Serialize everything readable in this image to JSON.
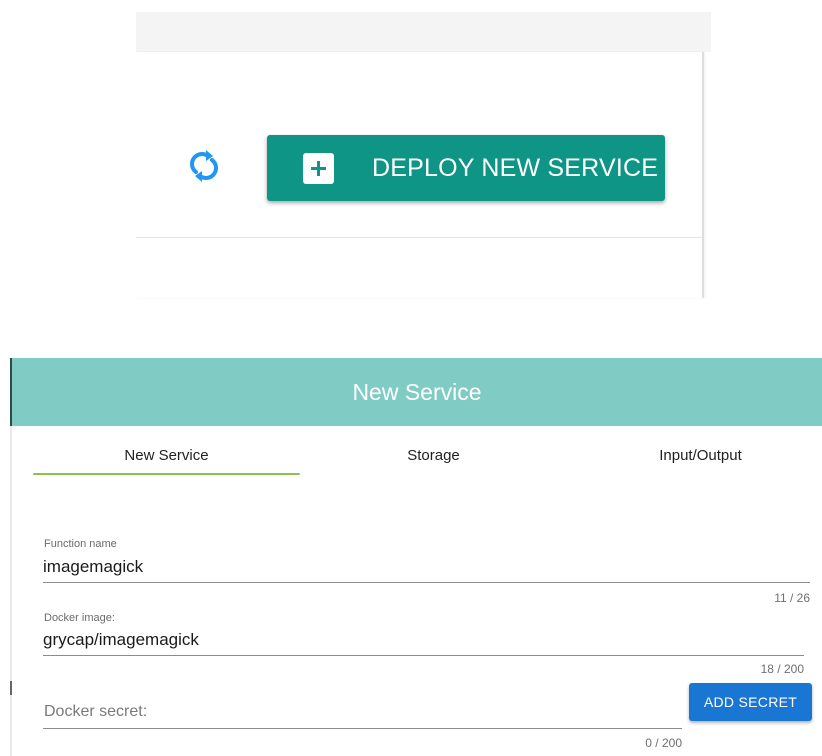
{
  "toolbar": {
    "refresh_icon": "refresh-icon",
    "deploy_icon": "plus-box-icon",
    "deploy_label": "DEPLOY NEW SERVICE"
  },
  "dialog": {
    "title": "New Service",
    "tabs": [
      {
        "label": "New Service",
        "active": true
      },
      {
        "label": "Storage",
        "active": false
      },
      {
        "label": "Input/Output",
        "active": false
      }
    ],
    "fields": {
      "function_name": {
        "label": "Function name",
        "value": "imagemagick",
        "counter": "11 / 26"
      },
      "docker_image": {
        "label": "Docker image:",
        "value": "grycap/imagemagick",
        "counter": "18 / 200"
      },
      "docker_secret": {
        "placeholder": "Docker secret:",
        "value": "",
        "counter": "0 / 200"
      }
    },
    "add_secret_label": "ADD SECRET"
  },
  "colors": {
    "deploy_button": "#0e9585",
    "dialog_header": "#80cbc4",
    "active_tab_indicator": "#8bc34a",
    "add_secret_button": "#1976d2",
    "refresh_icon": "#2196f3"
  }
}
